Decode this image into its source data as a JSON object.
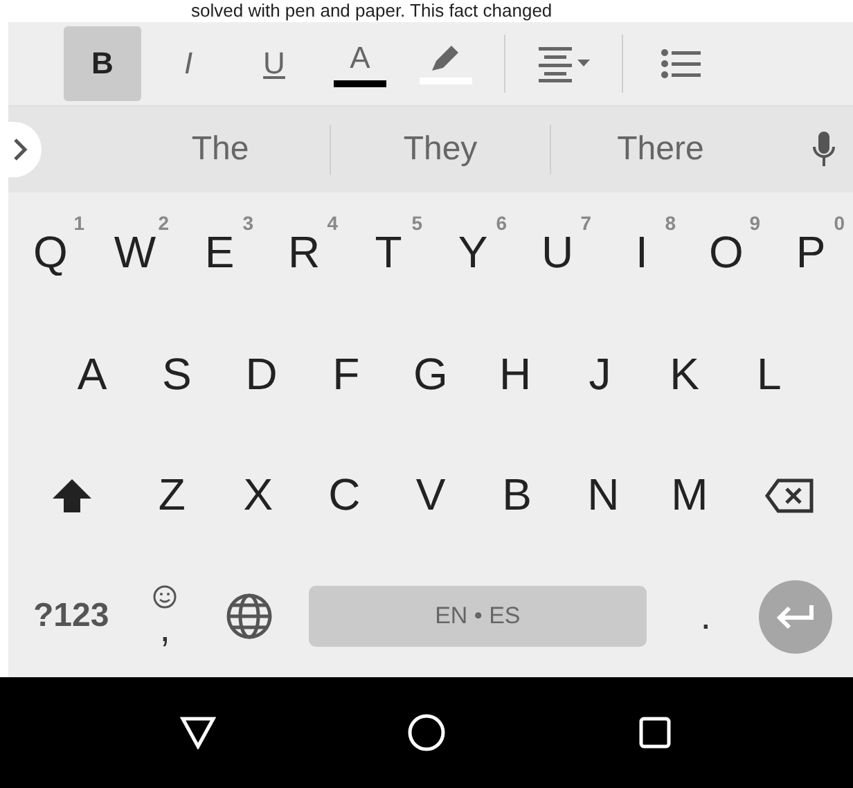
{
  "document": {
    "text": "solved with pen and paper. This fact changed"
  },
  "toolbar": [
    {
      "kind": "bold",
      "label": "B",
      "selected": true
    },
    {
      "kind": "italic",
      "label": "I",
      "selected": false
    },
    {
      "kind": "underline",
      "label": "U",
      "selected": false
    },
    {
      "kind": "text_color",
      "label": "A",
      "selected": false,
      "color": "#000000"
    },
    {
      "kind": "highlight",
      "selected": false,
      "color": "#ffffff"
    },
    {
      "kind": "divider"
    },
    {
      "kind": "align",
      "selected": false
    },
    {
      "kind": "divider"
    },
    {
      "kind": "list",
      "selected": false
    }
  ],
  "suggestions": [
    "The",
    "They",
    "There"
  ],
  "rows": [
    [
      {
        "kind": "letter",
        "label": "Q",
        "hint": "1"
      },
      {
        "kind": "letter",
        "label": "W",
        "hint": "2"
      },
      {
        "kind": "letter",
        "label": "E",
        "hint": "3"
      },
      {
        "kind": "letter",
        "label": "R",
        "hint": "4"
      },
      {
        "kind": "letter",
        "label": "T",
        "hint": "5"
      },
      {
        "kind": "letter",
        "label": "Y",
        "hint": "6"
      },
      {
        "kind": "letter",
        "label": "U",
        "hint": "7"
      },
      {
        "kind": "letter",
        "label": "I",
        "hint": "8"
      },
      {
        "kind": "letter",
        "label": "O",
        "hint": "9"
      },
      {
        "kind": "letter",
        "label": "P",
        "hint": "0"
      }
    ],
    [
      {
        "kind": "letter",
        "label": "A"
      },
      {
        "kind": "letter",
        "label": "S"
      },
      {
        "kind": "letter",
        "label": "D"
      },
      {
        "kind": "letter",
        "label": "F"
      },
      {
        "kind": "letter",
        "label": "G"
      },
      {
        "kind": "letter",
        "label": "H"
      },
      {
        "kind": "letter",
        "label": "J"
      },
      {
        "kind": "letter",
        "label": "K"
      },
      {
        "kind": "letter",
        "label": "L"
      }
    ],
    [
      {
        "kind": "shift"
      },
      {
        "kind": "letter",
        "label": "Z"
      },
      {
        "kind": "letter",
        "label": "X"
      },
      {
        "kind": "letter",
        "label": "C"
      },
      {
        "kind": "letter",
        "label": "V"
      },
      {
        "kind": "letter",
        "label": "B"
      },
      {
        "kind": "letter",
        "label": "N"
      },
      {
        "kind": "letter",
        "label": "M"
      },
      {
        "kind": "backspace"
      }
    ],
    [
      {
        "kind": "symbols",
        "label": "?123"
      },
      {
        "kind": "comma",
        "label": ","
      },
      {
        "kind": "globe"
      },
      {
        "kind": "space",
        "label": "EN • ES"
      },
      {
        "kind": "period",
        "label": "."
      },
      {
        "kind": "enter"
      }
    ]
  ]
}
